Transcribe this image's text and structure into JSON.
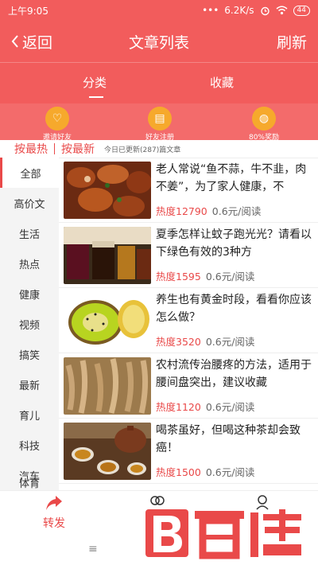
{
  "status_bar": {
    "time": "上午9:05",
    "dots": "•••",
    "speed": "6.2K/s",
    "battery": "44"
  },
  "nav": {
    "back_label": "返回",
    "title": "文章列表",
    "refresh_label": "刷新"
  },
  "tabs": [
    {
      "label": "分类",
      "active": true
    },
    {
      "label": "收藏",
      "active": false
    }
  ],
  "promo": [
    {
      "label": "邀请好友",
      "icon": "invite-icon"
    },
    {
      "label": "好友注册",
      "icon": "register-icon"
    },
    {
      "label": "80%奖励",
      "icon": "reward-icon"
    }
  ],
  "sort": {
    "hot": "按最热",
    "new": "按最新",
    "updated": "今日已更新(287)篇文章"
  },
  "categories": [
    "全部",
    "高价文",
    "生活",
    "热点",
    "健康",
    "视频",
    "搞笑",
    "最新",
    "育儿",
    "科技",
    "汽车",
    "体育"
  ],
  "articles": [
    {
      "title": "老人常说“鱼不蒜，牛不韭，肉不姜”，为了家人健康，不",
      "heat": "热度12790",
      "price": "0.6元/阅读"
    },
    {
      "title": "夏季怎样让蚊子跑光光？请看以下绿色有效的3种方",
      "heat": "热度1595",
      "price": "0.6元/阅读"
    },
    {
      "title": "养生也有黄金时段，看看你应该怎么做？",
      "heat": "热度3520",
      "price": "0.6元/阅读"
    },
    {
      "title": "农村流传治腰疼的方法，适用于腰间盘突出，建议收藏",
      "heat": "热度1120",
      "price": "0.6元/阅读"
    },
    {
      "title": "喝茶虽好，但喝这种茶却会致癌！",
      "heat": "热度1500",
      "price": "0.6元/阅读"
    }
  ],
  "bottom": {
    "share_label": "转发",
    "menu_glyph": "≡"
  },
  "colors": {
    "brand": "#f25c5c",
    "accent": "#e94949",
    "promo_icon": "#f6a92c"
  }
}
